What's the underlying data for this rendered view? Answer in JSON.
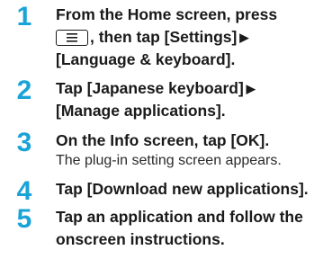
{
  "steps": [
    {
      "number": "1",
      "line1": "From the Home screen, press",
      "line2_suffix": ", then tap [Settings]",
      "line3": "[Language & keyboard].",
      "menu_key_icon": "menu-key-icon"
    },
    {
      "number": "2",
      "line1": "Tap [Japanese keyboard]",
      "line2": "[Manage applications]."
    },
    {
      "number": "3",
      "line1": "On the Info screen, tap [OK].",
      "note": "The plug-in setting screen appears."
    },
    {
      "number": "4",
      "line1": "Tap [Download new applications]."
    },
    {
      "number": "5",
      "line1": "Tap an application and follow the",
      "line2": "onscreen instructions."
    }
  ],
  "arrow_glyph": "▶",
  "accent_color": "#1aa3d6"
}
